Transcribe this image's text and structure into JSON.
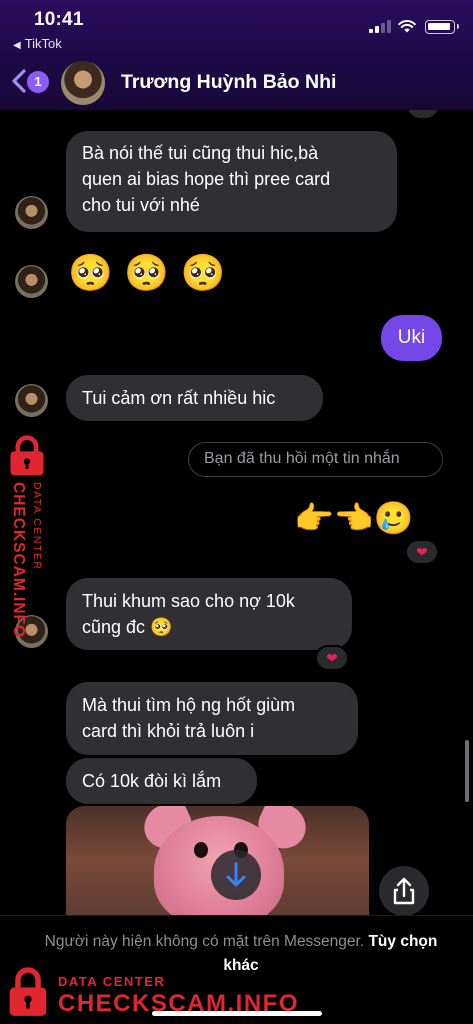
{
  "status_bar": {
    "time": "10:41",
    "back_app_label": "TikTok"
  },
  "header": {
    "unread_count": "1",
    "contact_name": "Trương Huỳnh Bảo Nhi",
    "accent_color": "#8b5cf6"
  },
  "messages": [
    {
      "id": "m1",
      "direction": "incoming",
      "text_line1": "Bà nói thế tui cũng thui hic,bà",
      "text_line2": "quen ai bias hope thì pree card",
      "text_line3": "cho tui với nhé"
    },
    {
      "id": "m2",
      "direction": "incoming",
      "emoji": "🥺 🥺 🥺"
    },
    {
      "id": "m3",
      "direction": "outgoing",
      "text": "Uki"
    },
    {
      "id": "m4",
      "direction": "incoming",
      "text": "Tui cảm ơn rất nhiều hic"
    },
    {
      "id": "m5",
      "direction": "system",
      "text": "Bạn đã thu hồi một tin nhắn"
    },
    {
      "id": "m6",
      "direction": "outgoing",
      "emoji": "👉👈🥲",
      "reaction": "❤"
    },
    {
      "id": "m7",
      "direction": "incoming",
      "text_line1": "Thui khum sao cho nợ 10k",
      "text_line2": "cũng đc 🥺",
      "reaction": "❤"
    },
    {
      "id": "m8",
      "direction": "incoming",
      "text_line1": "Mà thui tìm hộ ng hốt giùm",
      "text_line2": "card thì khỏi trả luôn i"
    },
    {
      "id": "m9",
      "direction": "incoming",
      "text": "Có 10k đòi kì lắm"
    },
    {
      "id": "m10",
      "direction": "incoming",
      "media": "video-thumbnail"
    }
  ],
  "footer": {
    "notice": "Người này hiện không có mặt trên Messenger.",
    "other_options": "Tùy chọn khác"
  },
  "watermark": {
    "small": "DATA CENTER",
    "big": "CHECKSCAM.INFO",
    "color": "#e0262e"
  },
  "icons": [
    "back-chevron-icon",
    "signal-icon",
    "wifi-icon",
    "battery-icon",
    "download-icon",
    "share-icon",
    "lock-icon",
    "heart-icon"
  ]
}
